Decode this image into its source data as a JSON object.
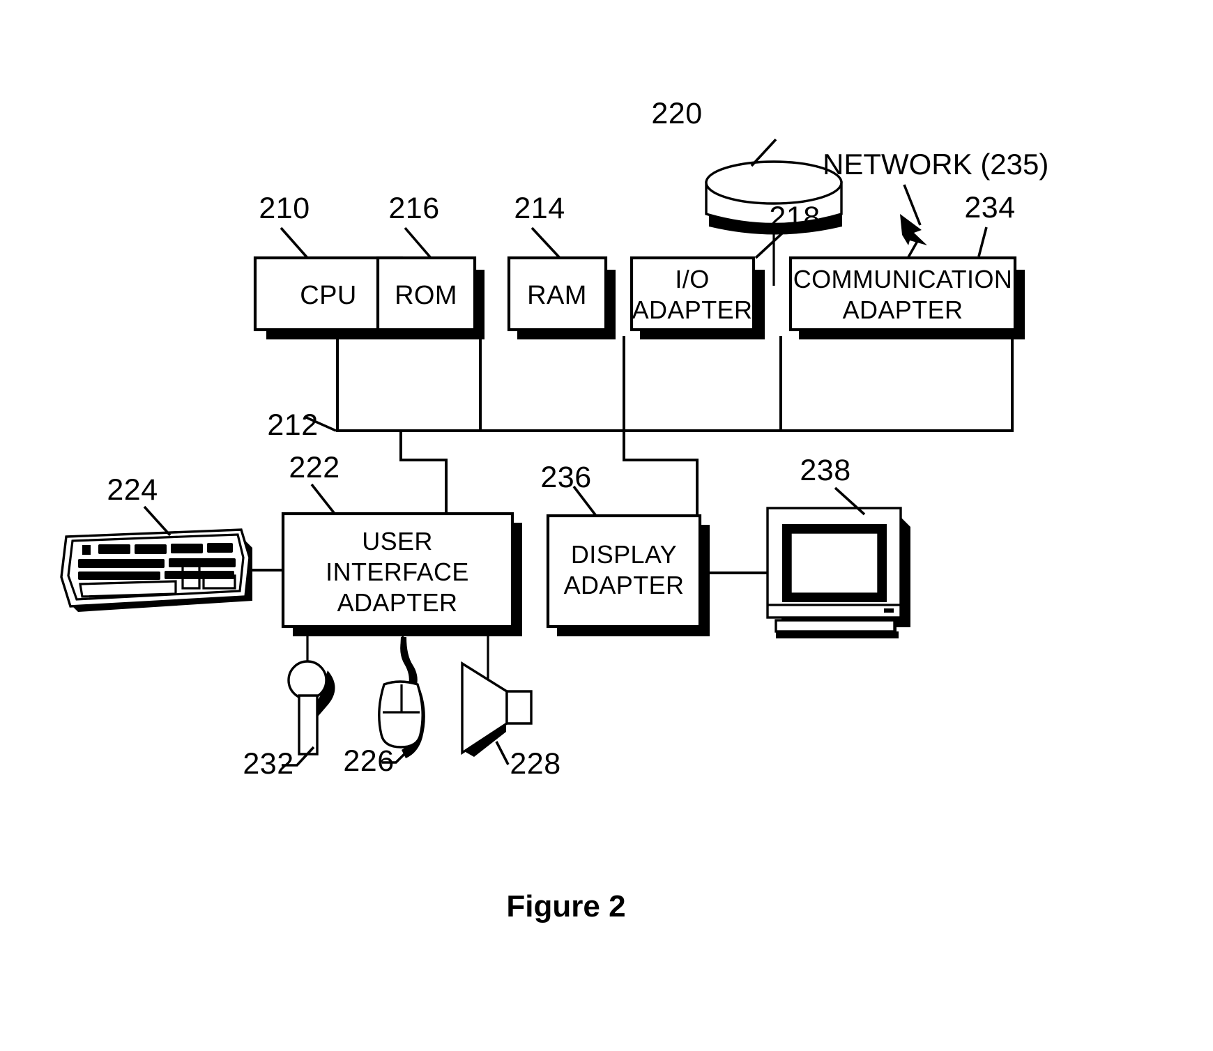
{
  "figure": {
    "caption": "Figure 2",
    "network_label": "NETWORK (235)"
  },
  "blocks": {
    "cpu": {
      "label": "CPU",
      "ref": "210"
    },
    "rom": {
      "label": "ROM",
      "ref": "216"
    },
    "ram": {
      "label": "RAM",
      "ref": "214"
    },
    "io_l1": {
      "label": "I/O",
      "ref": "218"
    },
    "io_l2": {
      "label": "ADAPTER"
    },
    "comm_l1": {
      "label": "COMMUNICATION",
      "ref": "234"
    },
    "comm_l2": {
      "label": "ADAPTER"
    },
    "uia_l1": {
      "label": "USER",
      "ref": "222"
    },
    "uia_l2": {
      "label": "INTERFACE"
    },
    "uia_l3": {
      "label": "ADAPTER"
    },
    "disp_l1": {
      "label": "DISPLAY",
      "ref": "236"
    },
    "disp_l2": {
      "label": "ADAPTER"
    }
  },
  "devices": {
    "disk": {
      "name": "disk-storage",
      "ref": "220"
    },
    "keyboard": {
      "name": "keyboard",
      "ref": "224"
    },
    "microphone": {
      "name": "microphone",
      "ref": "232"
    },
    "mouse": {
      "name": "mouse",
      "ref": "226"
    },
    "speaker": {
      "name": "speaker",
      "ref": "228"
    },
    "monitor": {
      "name": "display-monitor",
      "ref": "238"
    }
  },
  "bus": {
    "name": "system-bus",
    "ref": "212"
  },
  "colors": {
    "ink": "#000000",
    "paper": "#ffffff"
  }
}
